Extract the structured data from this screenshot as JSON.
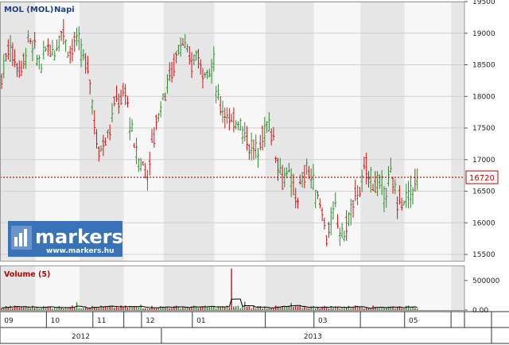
{
  "header": {
    "symbol": "MOL (MOL)",
    "period": "Napi"
  },
  "volume_panel": {
    "title": "Volume (5)"
  },
  "watermark": {
    "brand": "markers",
    "url": "www.markers.hu"
  },
  "colors": {
    "up": "#2e8b2e",
    "down": "#d10f0f",
    "title": "#1f3f86",
    "last_price": "#c00000",
    "band_shade": "#e6e6e6",
    "band_light": "#f7f7f7"
  },
  "chart_data": [
    {
      "type": "candlestick",
      "title": "MOL (MOL) Napi",
      "x_unit": "trading day",
      "x_labels": [
        {
          "label": "09",
          "day": 0
        },
        {
          "label": "10",
          "day": 21
        },
        {
          "label": "11",
          "day": 42
        },
        {
          "label": "12",
          "day": 64
        },
        {
          "label": "01",
          "day": 87
        },
        {
          "label": "03",
          "day": 142
        },
        {
          "label": "05",
          "day": 183
        }
      ],
      "years": [
        {
          "label": "2012",
          "from_day": 0,
          "to_day": 73
        },
        {
          "label": "2013",
          "from_day": 73,
          "to_day": 210
        }
      ],
      "ylim": [
        15400,
        19500
      ],
      "yticks": [
        15500,
        16000,
        16500,
        17000,
        17500,
        18000,
        18500,
        19000,
        19500
      ],
      "last_price": 16720,
      "close_path": [
        [
          0,
          18300
        ],
        [
          3,
          18800
        ],
        [
          6,
          18600
        ],
        [
          9,
          18400
        ],
        [
          12,
          18900
        ],
        [
          15,
          18700
        ],
        [
          18,
          18500
        ],
        [
          21,
          18800
        ],
        [
          24,
          18700
        ],
        [
          27,
          19100
        ],
        [
          29,
          18900
        ],
        [
          31,
          18700
        ],
        [
          34,
          18900
        ],
        [
          37,
          18600
        ],
        [
          40,
          18300
        ],
        [
          42,
          17600
        ],
        [
          44,
          17100
        ],
        [
          46,
          17300
        ],
        [
          49,
          17500
        ],
        [
          52,
          18000
        ],
        [
          54,
          17900
        ],
        [
          56,
          18100
        ],
        [
          58,
          17600
        ],
        [
          60,
          17200
        ],
        [
          62,
          17000
        ],
        [
          64,
          16900
        ],
        [
          66,
          16800
        ],
        [
          68,
          17200
        ],
        [
          70,
          17600
        ],
        [
          72,
          17900
        ],
        [
          74,
          18100
        ],
        [
          76,
          18300
        ],
        [
          78,
          18500
        ],
        [
          80,
          18800
        ],
        [
          82,
          18900
        ],
        [
          84,
          18600
        ],
        [
          86,
          18500
        ],
        [
          88,
          18700
        ],
        [
          90,
          18500
        ],
        [
          92,
          18450
        ],
        [
          94,
          18400
        ],
        [
          96,
          18500
        ],
        [
          98,
          17900
        ],
        [
          101,
          17800
        ],
        [
          104,
          17500
        ],
        [
          107,
          17700
        ],
        [
          110,
          17400
        ],
        [
          113,
          17200
        ],
        [
          116,
          17100
        ],
        [
          119,
          17500
        ],
        [
          121,
          17600
        ],
        [
          123,
          17300
        ],
        [
          125,
          17000
        ],
        [
          127,
          16700
        ],
        [
          129,
          16800
        ],
        [
          131,
          16600
        ],
        [
          133,
          16400
        ],
        [
          136,
          16600
        ],
        [
          138,
          16900
        ],
        [
          140,
          16700
        ],
        [
          142,
          16500
        ],
        [
          145,
          16200
        ],
        [
          147,
          15800
        ],
        [
          149,
          16000
        ],
        [
          151,
          16200
        ],
        [
          153,
          15900
        ],
        [
          155,
          15800
        ],
        [
          157,
          16100
        ],
        [
          159,
          16300
        ],
        [
          161,
          16500
        ],
        [
          163,
          16600
        ],
        [
          165,
          16900
        ],
        [
          167,
          16700
        ],
        [
          170,
          16600
        ],
        [
          173,
          16500
        ],
        [
          176,
          16700
        ],
        [
          179,
          16400
        ],
        [
          182,
          16300
        ],
        [
          185,
          16500
        ],
        [
          188,
          16720
        ]
      ],
      "annotations": [
        {
          "type": "horizontal_line",
          "value": 16720,
          "style": "dotted",
          "color": "#c00000"
        }
      ]
    },
    {
      "type": "bar",
      "title": "Volume (5)",
      "ylim": [
        0,
        700000
      ],
      "yticks": [
        0,
        500000
      ],
      "ytick_labels": [
        "0.00",
        "500000"
      ],
      "typical_volume": 60000,
      "peaks": [
        {
          "day": 34,
          "value": 130000
        },
        {
          "day": 63,
          "value": 90000
        },
        {
          "day": 104,
          "value": 700000
        },
        {
          "day": 110,
          "value": 140000
        },
        {
          "day": 131,
          "value": 120000
        },
        {
          "day": 160,
          "value": 80000
        }
      ],
      "ma_period": 5
    }
  ]
}
